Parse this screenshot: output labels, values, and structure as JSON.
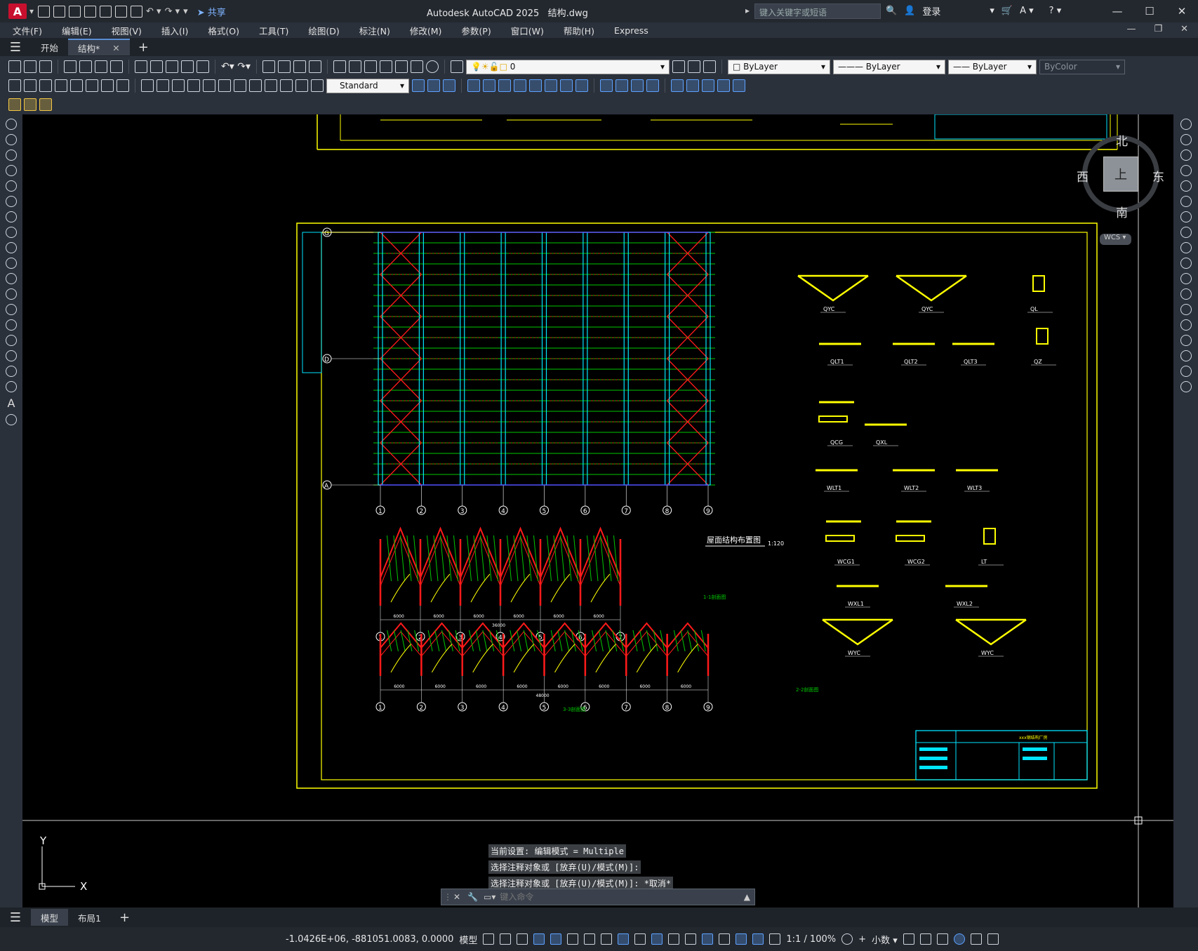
{
  "app": {
    "title": "Autodesk AutoCAD 2025",
    "file": "结构.dwg",
    "share_label": "共享",
    "search_placeholder": "键入关键字或短语",
    "login_label": "登录"
  },
  "menu": [
    "文件(F)",
    "编辑(E)",
    "视图(V)",
    "插入(I)",
    "格式(O)",
    "工具(T)",
    "绘图(D)",
    "标注(N)",
    "修改(M)",
    "参数(P)",
    "窗口(W)",
    "帮助(H)",
    "Express"
  ],
  "tabs": [
    {
      "label": "开始",
      "active": false
    },
    {
      "label": "结构*",
      "active": true
    }
  ],
  "toolbar": {
    "layer_value": "0",
    "color_value": "ByLayer",
    "linetype_value": "ByLayer",
    "lineweight_value": "ByLayer",
    "plotstyle_value": "ByColor",
    "textstyle_value": "Standard"
  },
  "viewcube": {
    "north": "北",
    "south": "南",
    "east": "东",
    "west": "西",
    "face": "上",
    "wcs": "WCS"
  },
  "drawing": {
    "plan_title": "屋面结构布置图",
    "plan_scale": "1:120",
    "grid_cols": [
      "1",
      "2",
      "3",
      "4",
      "5",
      "6",
      "7",
      "8",
      "9"
    ],
    "grid_rows": [
      "G",
      "D",
      "A"
    ],
    "sections": [
      "1-1剖面图",
      "2-2剖面图",
      "3-3剖面图"
    ],
    "details": [
      "QYC",
      "QYC",
      "QL",
      "QLT1",
      "QLT2",
      "QLT3",
      "QZ",
      "QCG",
      "QXL",
      "WLT1",
      "WLT2",
      "WLT3",
      "WCG1",
      "WCG2",
      "LT",
      "WXL1",
      "WXL2",
      "WYC",
      "WYC"
    ],
    "title_block_name": "xxx钢结构厂房",
    "dim_total_a": "36000",
    "dim_total_b": "48000",
    "bay": "6000"
  },
  "ucs": {
    "x": "X",
    "y": "Y"
  },
  "command": {
    "history": [
      "当前设置: 编辑模式 = Multiple",
      "选择注释对象或 [放弃(U)/模式(M)]:",
      "选择注释对象或 [放弃(U)/模式(M)]: *取消*"
    ],
    "placeholder": "键入命令"
  },
  "layouts": [
    {
      "label": "模型",
      "active": true
    },
    {
      "label": "布局1",
      "active": false
    }
  ],
  "status": {
    "coords": "-1.0426E+06, -881051.0083, 0.0000",
    "model_label": "模型",
    "scale": "1:1 / 100%",
    "units": "小数"
  },
  "colors": {
    "accent": "#5da2ff",
    "steel": "#ff1a1a",
    "purlin": "#00e5ff",
    "green": "#00c800",
    "frame": "#ffff00"
  }
}
